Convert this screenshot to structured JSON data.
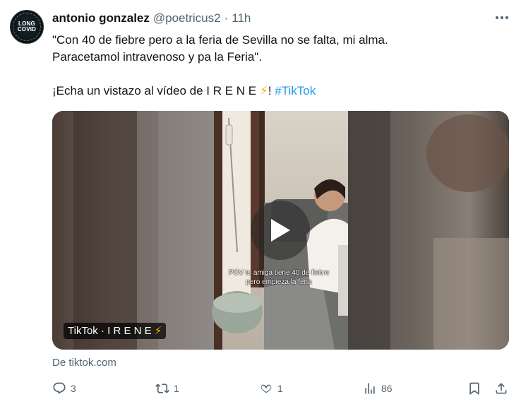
{
  "author": {
    "name": "antonio gonzalez",
    "handle": "@poetricus2",
    "separator": "·",
    "time": "11h",
    "avatar_text_1": "LONG",
    "avatar_text_2": "COVID"
  },
  "more_icon": "ellipsis-icon",
  "tweet": {
    "line1": "\"Con 40 de fiebre pero a la feria de Sevilla  no se falta, mi alma.",
    "line2": "Paracetamol intravenoso y pa la Feria\".",
    "line3_text": "¡Echa un vistazo al vídeo de I R E N E ",
    "line3_emoji": "⚡",
    "line3_after": "! ",
    "hashtag": "#TikTok"
  },
  "card": {
    "video_caption": "POV tu amiga tiene 40 de fiebre pero empieza la feria",
    "badge_text": "TikTok · I R E N E ",
    "badge_emoji": "⚡",
    "play_icon": "play-icon"
  },
  "source": "De tiktok.com",
  "actions": {
    "reply_count": "3",
    "repost_count": "1",
    "like_count": "1",
    "views_count": "86"
  },
  "colors": {
    "link": "#1d9bf0",
    "secondary_text": "#536471",
    "primary_text": "#0f1419"
  }
}
